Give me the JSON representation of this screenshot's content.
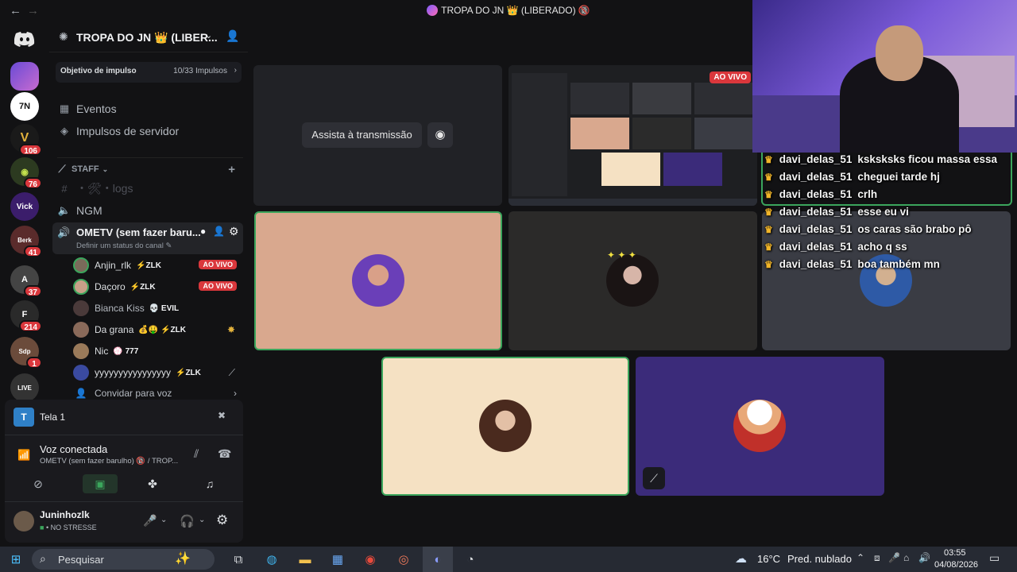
{
  "window": {
    "title": "TROPA DO JN 👑 (LIBERADO) 🔞"
  },
  "servers": [
    {
      "name": "user-avatar",
      "badge": ""
    },
    {
      "name": "server-7tv",
      "badge": ""
    },
    {
      "name": "server-v",
      "badge": "106"
    },
    {
      "name": "server-green",
      "badge": "76"
    },
    {
      "name": "server-vick",
      "badge": ""
    },
    {
      "name": "server-berk",
      "badge": "41"
    },
    {
      "name": "server-a",
      "badge": "37"
    },
    {
      "name": "server-f",
      "badge": "214"
    },
    {
      "name": "server-sdp",
      "badge": "1"
    },
    {
      "name": "server-live",
      "badge": ""
    }
  ],
  "sidebar": {
    "server_name": "TROPA DO JN 👑 (LIBER...",
    "boost_label": "Objetivo de impulso",
    "boost_count": "10/33 Impulsos",
    "menu": [
      {
        "label": "Eventos"
      },
      {
        "label": "Impulsos de servidor"
      }
    ],
    "category": "STAFF",
    "channels": [
      {
        "label": "・🛠・logs"
      },
      {
        "label": "NGM"
      }
    ],
    "active_voice": {
      "label": "OMETV (sem fazer baru...",
      "status": "Definir um status do canal"
    },
    "members": [
      {
        "name": "Anjin_rlk",
        "tag": "⚡ZLK",
        "live": "AO VIVO"
      },
      {
        "name": "Daçoro",
        "tag": "⚡ZLK",
        "live": "AO VIVO"
      },
      {
        "name": "Bianca Kiss",
        "tag": "💀 EVIL",
        "live": ""
      },
      {
        "name": "Da grana",
        "tag": "💰🤑 ⚡ZLK",
        "live": ""
      },
      {
        "name": "Nic",
        "tag": "💮 777",
        "live": ""
      },
      {
        "name": "yyyyyyyyyyyyyyyy",
        "tag": "⚡ZLK",
        "live": ""
      }
    ],
    "invite": "Convidar para voz"
  },
  "voice_panel": {
    "screen_label": "Tela 1",
    "connected": "Voz conectada",
    "channel_info": "OMETV (sem fazer barulho) 🔞 / TROP...",
    "username": "Juninhozlk",
    "user_status": "NO STRESSE"
  },
  "stage": {
    "watch_button": "Assista à transmissão",
    "live_badge": "AO VIVO"
  },
  "chat": [
    {
      "user": "davi_delas_51",
      "msg": "ksksksks ficou massa essa"
    },
    {
      "user": "davi_delas_51",
      "msg": "cheguei tarde hj"
    },
    {
      "user": "davi_delas_51",
      "msg": "crlh"
    },
    {
      "user": "davi_delas_51",
      "msg": "esse eu vi"
    },
    {
      "user": "davi_delas_51",
      "msg": "os caras são brabo pô"
    },
    {
      "user": "davi_delas_51",
      "msg": "acho q ss"
    },
    {
      "user": "davi_delas_51",
      "msg": "boa também mn"
    }
  ],
  "taskbar": {
    "search": "Pesquisar",
    "weather_temp": "16°C",
    "weather_desc": "Pred. nublado",
    "time": "03:55",
    "date": "04/08/2026"
  },
  "colors": {
    "accent": "#5865f2",
    "live_red": "#da373c",
    "speaking_green": "#3ba55c",
    "crown": "#f0b429"
  }
}
